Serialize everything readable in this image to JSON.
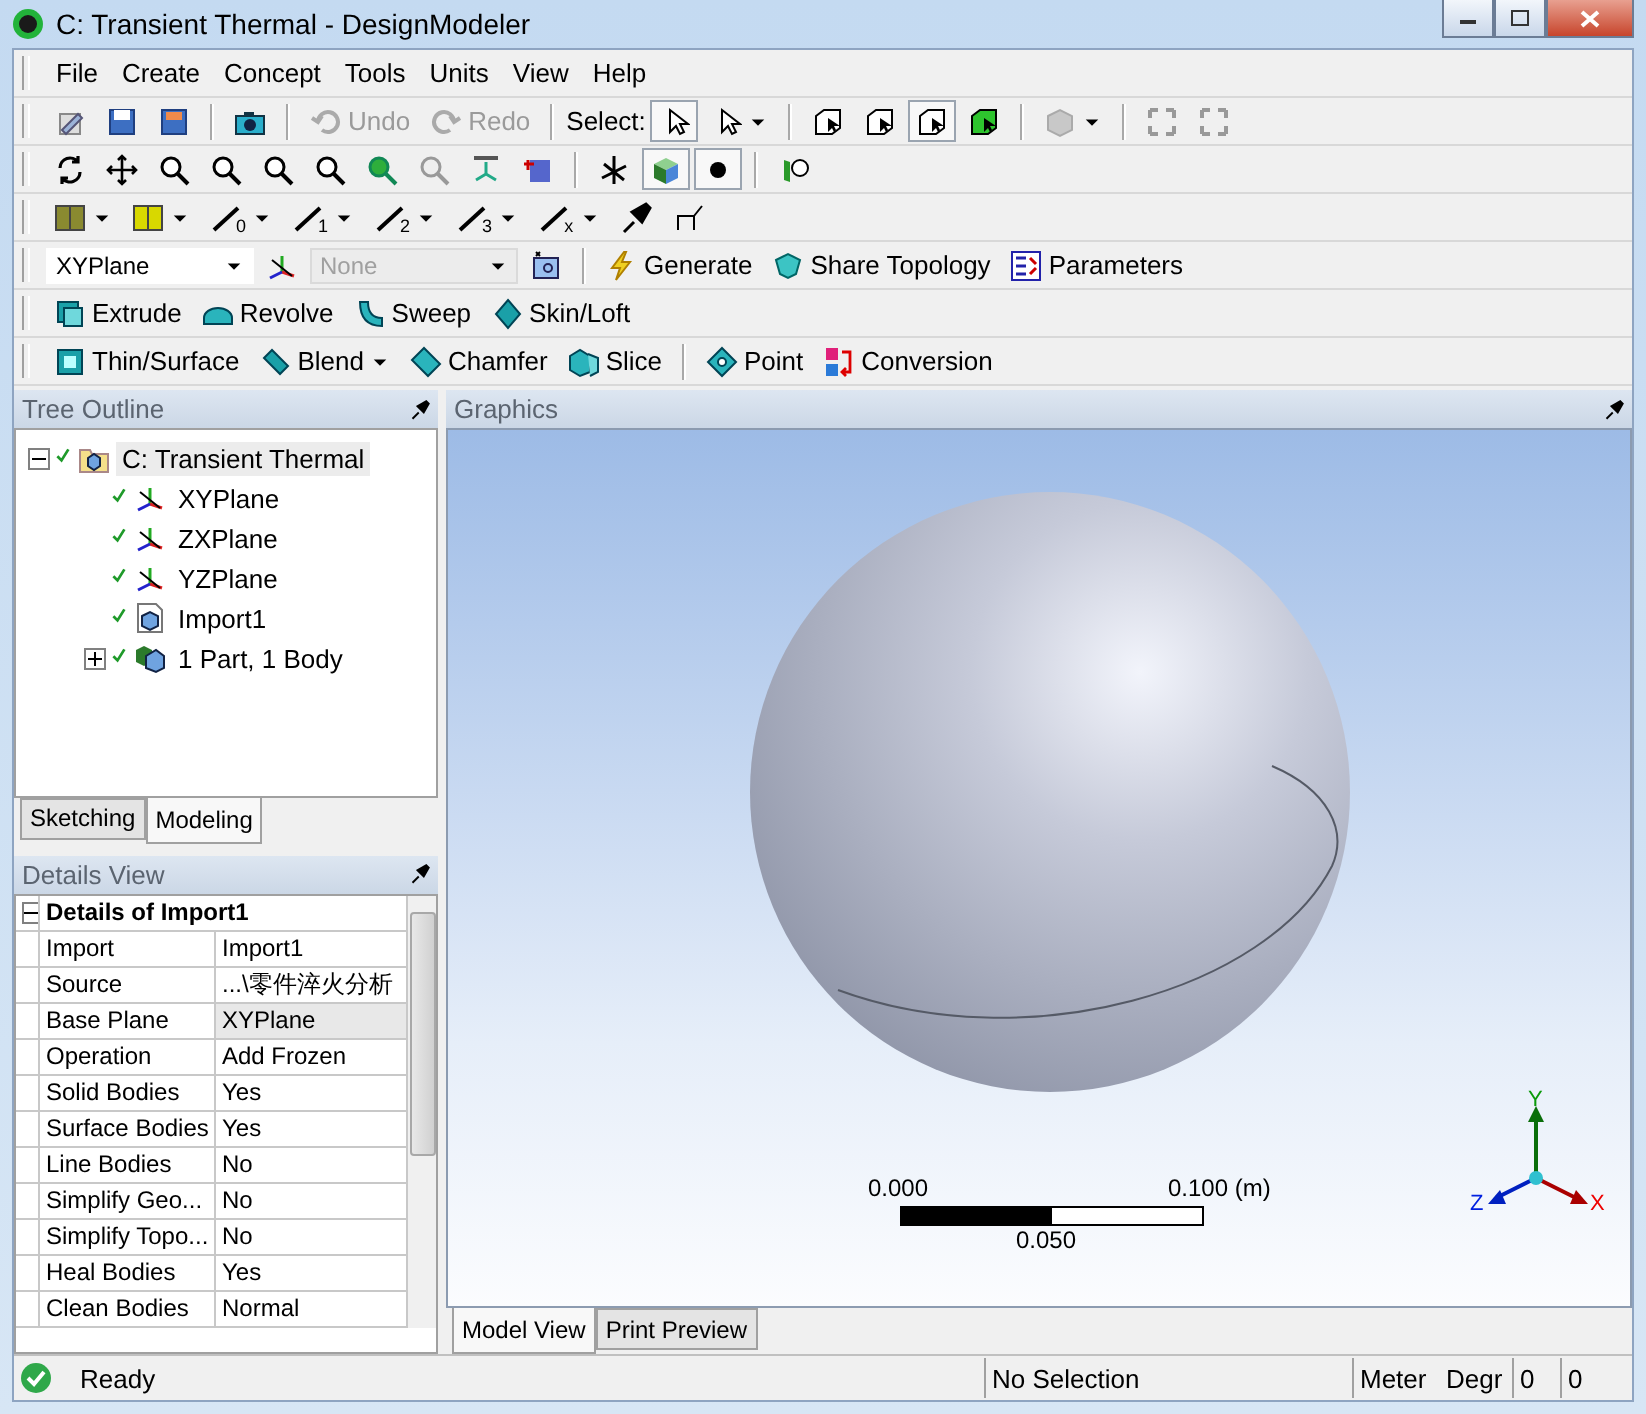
{
  "window": {
    "title": "C: Transient Thermal - DesignModeler"
  },
  "menu": [
    "File",
    "Create",
    "Concept",
    "Tools",
    "Units",
    "View",
    "Help"
  ],
  "edit_toolbar": {
    "undo": {
      "label": "Undo",
      "disabled": true
    },
    "redo": {
      "label": "Redo",
      "disabled": true
    },
    "select_label": "Select:",
    "select_mode": {
      "selected": true
    },
    "select_filters": [
      {
        "selected": false
      },
      {
        "selected": false
      },
      {
        "selected": true
      },
      {
        "selected": false
      }
    ]
  },
  "view_toolbar": {
    "display_toggles": [
      {
        "selected": true
      },
      {
        "selected": true
      }
    ]
  },
  "constraint_toolbar": {
    "line_filters": [
      "0",
      "1",
      "2",
      "3",
      "x"
    ]
  },
  "plane_toolbar": {
    "plane": "XYPlane",
    "sketch": {
      "value": "None",
      "disabled": true
    },
    "actions": [
      "Generate",
      "Share Topology",
      "Parameters"
    ]
  },
  "features_1": [
    "Extrude",
    "Revolve",
    "Sweep",
    "Skin/Loft"
  ],
  "features_2": {
    "left": [
      {
        "label": "Thin/Surface",
        "dropdown": false
      },
      {
        "label": "Blend",
        "dropdown": true
      },
      {
        "label": "Chamfer",
        "dropdown": false
      },
      {
        "label": "Slice",
        "dropdown": false
      }
    ],
    "right": [
      {
        "label": "Point",
        "dropdown": false
      },
      {
        "label": "Conversion",
        "dropdown": false
      }
    ]
  },
  "tree": {
    "title": "Tree Outline",
    "nodes": [
      {
        "label": "C: Transient Thermal",
        "kind": "model",
        "expanded": true,
        "selected": true,
        "children": [
          {
            "label": "XYPlane",
            "kind": "plane",
            "selected": false
          },
          {
            "label": "ZXPlane",
            "kind": "plane",
            "selected": false
          },
          {
            "label": "YZPlane",
            "kind": "plane",
            "selected": false
          },
          {
            "label": "Import1",
            "kind": "import",
            "selected": false
          },
          {
            "label": "1 Part, 1 Body",
            "kind": "part",
            "expanded": false,
            "selected": false
          }
        ]
      }
    ]
  },
  "tree_tabs": [
    {
      "label": "Sketching",
      "selected": false
    },
    {
      "label": "Modeling",
      "selected": true
    }
  ],
  "details": {
    "title": "Details View",
    "heading": "Details of Import1",
    "rows": [
      {
        "name": "Import",
        "value": "Import1",
        "selected": false
      },
      {
        "name": "Source",
        "value": "...\\零件淬火分析",
        "selected": false
      },
      {
        "name": "Base Plane",
        "value": "XYPlane",
        "selected": true
      },
      {
        "name": "Operation",
        "value": "Add Frozen",
        "selected": false
      },
      {
        "name": "Solid Bodies",
        "value": "Yes",
        "selected": false
      },
      {
        "name": "Surface Bodies",
        "value": "Yes",
        "selected": false
      },
      {
        "name": "Line Bodies",
        "value": "No",
        "selected": false
      },
      {
        "name": "Simplify Geo...",
        "value": "No",
        "selected": false
      },
      {
        "name": "Simplify Topo...",
        "value": "No",
        "selected": false
      },
      {
        "name": "Heal Bodies",
        "value": "Yes",
        "selected": false
      },
      {
        "name": "Clean Bodies",
        "value": "Normal",
        "selected": false
      }
    ]
  },
  "graphics": {
    "title": "Graphics",
    "scale": {
      "start": "0.000",
      "end": "0.100 (m)",
      "mid": "0.050"
    },
    "axes": {
      "x": "X",
      "y": "Y",
      "z": "Z"
    }
  },
  "graphics_tabs": [
    {
      "label": "Model View",
      "selected": true
    },
    {
      "label": "Print Preview",
      "selected": false
    }
  ],
  "status": {
    "state": "Ready",
    "selection": "No Selection",
    "units": "Meter",
    "angle": "Degr",
    "values": [
      "0",
      "0"
    ]
  }
}
